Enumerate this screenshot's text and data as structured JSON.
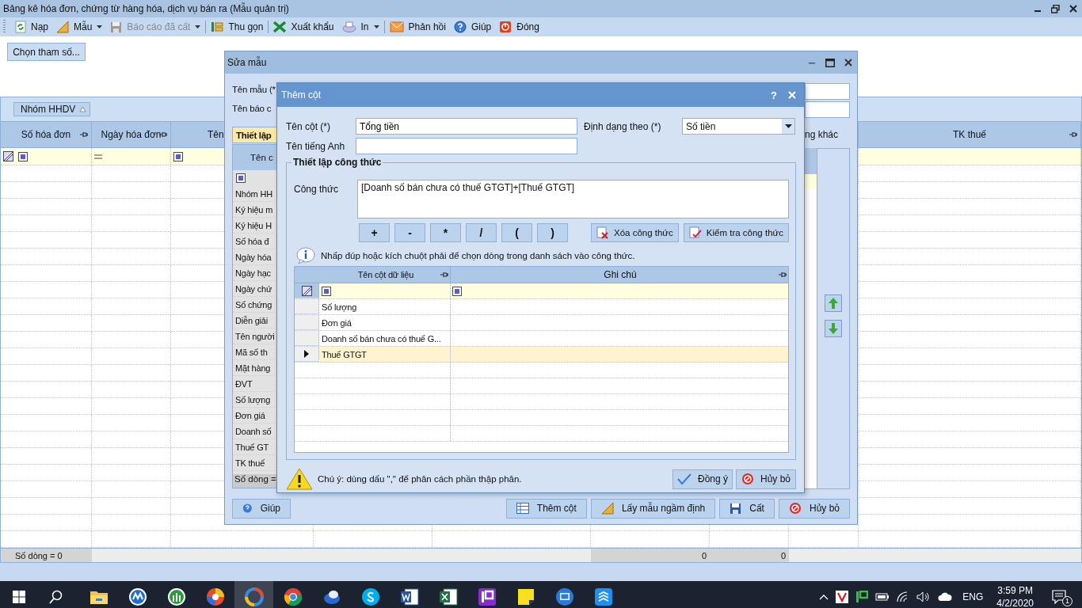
{
  "window": {
    "title": "Bảng kê hóa đơn, chứng từ hàng hóa, dịch vụ bán ra (Mẫu quản trị)"
  },
  "toolbar": [
    {
      "label": "Nạp",
      "dropdown": false,
      "disabled": false
    },
    {
      "label": "Mẫu",
      "dropdown": true,
      "disabled": false
    },
    {
      "label": "Báo cáo đã cất",
      "dropdown": true,
      "disabled": true
    },
    {
      "label": "Thu gọn",
      "dropdown": false,
      "disabled": false
    },
    {
      "label": "Xuất khẩu",
      "dropdown": false,
      "disabled": false
    },
    {
      "label": "In",
      "dropdown": true,
      "disabled": false
    },
    {
      "label": "Phản hồi",
      "dropdown": false,
      "disabled": false
    },
    {
      "label": "Giúp",
      "dropdown": false,
      "disabled": false
    },
    {
      "label": "Đóng",
      "dropdown": false,
      "disabled": false
    }
  ],
  "parameters_button": "Chọn tham số...",
  "group_panel": {
    "chip": "Nhóm HHDV"
  },
  "grid": {
    "columns": [
      "Số hóa đơn",
      "Ngày hóa đơn",
      "Tên",
      "TK thuế"
    ],
    "row_count": "Số dòng = 0",
    "totals": [
      "0",
      "0"
    ]
  },
  "edit_template_dialog": {
    "title": "Sửa mẫu",
    "fields": [
      "Tên mẫu (*",
      "Tên báo c"
    ],
    "tab": {
      "label": "Thiết lập",
      "selected": true
    },
    "list_header": "Tên c",
    "list_items": [
      "Nhóm HH",
      "Ký hiệu m",
      "Ký hiệu H",
      "Số hóa đ",
      "Ngày hóa",
      "Ngày hạc",
      "Ngày chứ",
      "Số chứng",
      "Diễn giải",
      "Tên người",
      "Mã số th",
      "Mặt hàng",
      "ĐVT",
      "Số lượng",
      "Đơn giá",
      "Doanh số",
      "Thuế GT",
      "TK thuế"
    ],
    "list_footer": "Số dòng =",
    "column_label": "ng khác",
    "buttons": [
      "Giúp",
      "Thêm cột",
      "Lấy mẫu ngầm định",
      "Cất",
      "Hủy bỏ"
    ]
  },
  "add_column_dialog": {
    "title": "Thêm cột",
    "help": "?",
    "column_name": {
      "label": "Tên cột (*)",
      "value": "Tổng tiền"
    },
    "english_name": {
      "label": "Tên tiếng Anh"
    },
    "format": {
      "label": "Định dạng theo (*)",
      "value": "Số tiền"
    },
    "formula_group": {
      "title": "Thiết lập công thức",
      "label": "Công thức",
      "value": "[Doanh số bán chưa có thuế GTGT]+[Thuế GTGT]",
      "operators": [
        "+",
        "-",
        "*",
        "/",
        "(",
        ")"
      ],
      "actions": [
        "Xóa công thức",
        "Kiểm tra công thức"
      ],
      "hint": "Nhấp đúp hoặc kích chuột phải để chọn dòng trong danh sách vào công thức.",
      "table": {
        "columns": [
          "Tên cột dữ liệu",
          "Ghi chú"
        ],
        "rows": [
          {
            "name": "Số lượng",
            "selected": false
          },
          {
            "name": "Đơn giá",
            "selected": false
          },
          {
            "name": "Doanh số bán chưa có thuế G...",
            "selected": false
          },
          {
            "name": "Thuế GTGT",
            "selected": true
          }
        ]
      }
    },
    "note": "Chú ý: dùng dấu \",\" để phân cách phần thập phân.",
    "buttons": [
      "Đồng ý",
      "Hủy bỏ"
    ]
  },
  "taskbar": {
    "language": "ENG",
    "time": "3:59 PM",
    "date": "4/2/2020",
    "notifications": "1"
  }
}
